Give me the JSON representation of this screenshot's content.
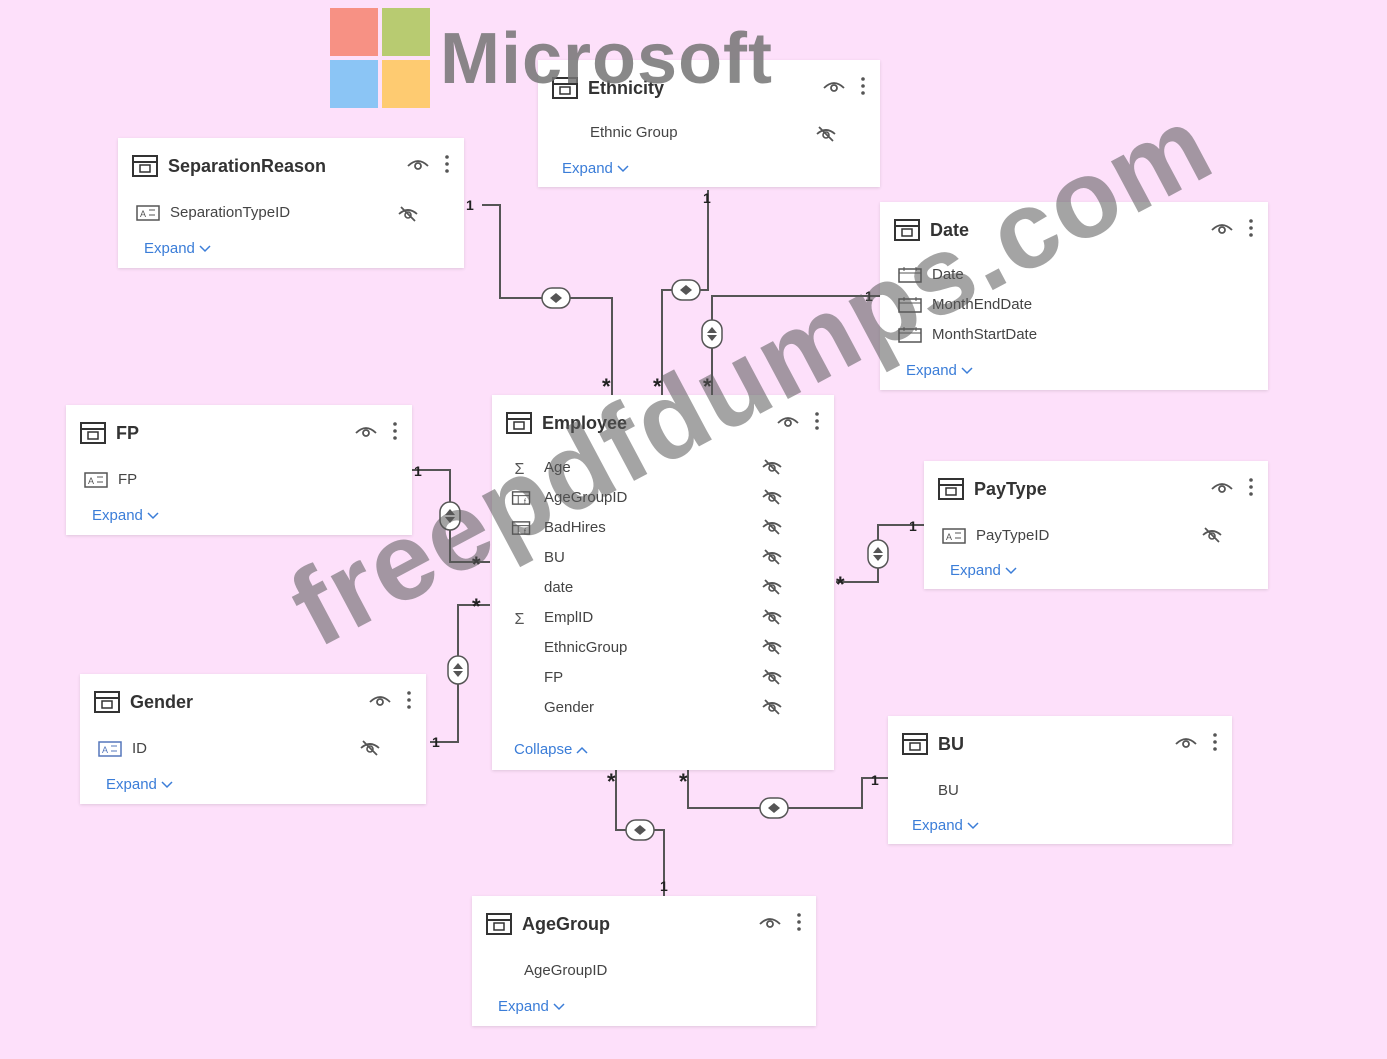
{
  "brand": {
    "name": "Microsoft",
    "colors": [
      "#f25022",
      "#7fba00",
      "#00a4ef",
      "#ffb900"
    ]
  },
  "watermark": "freepdfdumps.com",
  "colors": {
    "background": "#fde0fa",
    "accent_link": "#3b7dd8",
    "line": "#555555"
  },
  "tables": {
    "ethnicity": {
      "title": "Ethnicity",
      "fields": [
        {
          "name": "Ethnic Group",
          "icon": "none",
          "hidden": true
        }
      ],
      "footer": "Expand"
    },
    "separation_reason": {
      "title": "SeparationReason",
      "fields": [
        {
          "name": "SeparationTypeID",
          "icon": "text-field-icon",
          "hidden": true
        }
      ],
      "footer": "Expand"
    },
    "date": {
      "title": "Date",
      "fields": [
        {
          "name": "Date",
          "icon": "calendar-icon"
        },
        {
          "name": "MonthEndDate",
          "icon": "calendar-icon"
        },
        {
          "name": "MonthStartDate",
          "icon": "calendar-icon"
        }
      ],
      "footer": "Expand"
    },
    "fp": {
      "title": "FP",
      "fields": [
        {
          "name": "FP",
          "icon": "text-field-icon"
        }
      ],
      "footer": "Expand"
    },
    "employee": {
      "title": "Employee",
      "fields": [
        {
          "name": "Age",
          "icon": "sigma-icon",
          "hidden": true
        },
        {
          "name": "AgeGroupID",
          "icon": "calc-table-icon",
          "hidden": true
        },
        {
          "name": "BadHires",
          "icon": "calc-table-icon",
          "hidden": true
        },
        {
          "name": "BU",
          "icon": "none",
          "hidden": true
        },
        {
          "name": "date",
          "icon": "none",
          "hidden": true
        },
        {
          "name": "EmplID",
          "icon": "sigma-icon",
          "hidden": true
        },
        {
          "name": "EthnicGroup",
          "icon": "none",
          "hidden": true
        },
        {
          "name": "FP",
          "icon": "none",
          "hidden": true
        },
        {
          "name": "Gender",
          "icon": "none",
          "hidden": true
        }
      ],
      "footer": "Collapse"
    },
    "paytype": {
      "title": "PayType",
      "fields": [
        {
          "name": "PayTypeID",
          "icon": "text-field-icon",
          "hidden": true
        }
      ],
      "footer": "Expand"
    },
    "gender": {
      "title": "Gender",
      "fields": [
        {
          "name": "ID",
          "icon": "text-field-icon",
          "hidden": true
        }
      ],
      "footer": "Expand"
    },
    "bu": {
      "title": "BU",
      "fields": [
        {
          "name": "BU",
          "icon": "none"
        }
      ],
      "footer": "Expand"
    },
    "agegroup": {
      "title": "AgeGroup",
      "fields": [
        {
          "name": "AgeGroupID",
          "icon": "none"
        }
      ],
      "footer": "Expand"
    }
  },
  "relationships": [
    {
      "from": "SeparationReason",
      "to": "Employee",
      "one": "1",
      "many": "*",
      "crossfilter": "single"
    },
    {
      "from": "Ethnicity",
      "to": "Employee",
      "one": "1",
      "many": "*",
      "crossfilter": "single"
    },
    {
      "from": "Date",
      "to": "Employee",
      "one": "1",
      "many": "*",
      "crossfilter": "both"
    },
    {
      "from": "FP",
      "to": "Employee",
      "one": "1",
      "many": "*",
      "crossfilter": "both"
    },
    {
      "from": "Gender",
      "to": "Employee",
      "one": "1",
      "many": "*",
      "crossfilter": "both"
    },
    {
      "from": "PayType",
      "to": "Employee",
      "one": "1",
      "many": "*",
      "crossfilter": "both"
    },
    {
      "from": "BU",
      "to": "Employee",
      "one": "1",
      "many": "*",
      "crossfilter": "single"
    },
    {
      "from": "AgeGroup",
      "to": "Employee",
      "one": "1",
      "many": "*",
      "crossfilter": "single"
    }
  ]
}
